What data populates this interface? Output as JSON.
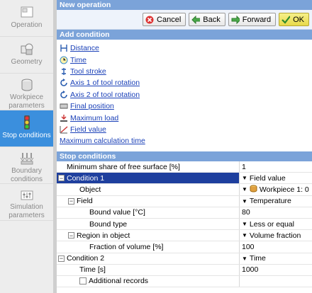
{
  "sidebar": {
    "items": [
      {
        "label": "Operation",
        "icon": "operation-icon"
      },
      {
        "label": "Geometry",
        "icon": "geometry-icon"
      },
      {
        "label": "Workpiece parameters",
        "icon": "workpiece-icon"
      },
      {
        "label": "Stop conditions",
        "icon": "traffic-light-icon",
        "active": true
      },
      {
        "label": "Boundary conditions",
        "icon": "boundary-icon"
      },
      {
        "label": "Simulation parameters",
        "icon": "simulation-icon"
      }
    ]
  },
  "header": {
    "title": "New operation"
  },
  "toolbar": {
    "cancel": "Cancel",
    "back": "Back",
    "forward": "Forward",
    "ok": "OK"
  },
  "add_condition": {
    "title": "Add condition",
    "items": [
      "Distance",
      "Time",
      "Tool stroke",
      "Axis 1 of tool rotation",
      "Axis 2 of tool rotation",
      "Final position",
      "Maximum load",
      "Field value",
      "Maximum calculation time"
    ]
  },
  "stop_conditions": {
    "title": "Stop conditions",
    "rows": [
      {
        "name": "Minimum share of free surface [%]",
        "value": "1"
      },
      {
        "name": "Condition 1",
        "value": "Field value"
      },
      {
        "name": "Object",
        "value": "Workpiece 1: 0"
      },
      {
        "name": "Field",
        "value": "Temperature"
      },
      {
        "name": "Bound value [°C]",
        "value": "80"
      },
      {
        "name": "Bound type",
        "value": "Less or equal"
      },
      {
        "name": "Region in object",
        "value": "Volume fraction"
      },
      {
        "name": "Fraction of volume [%]",
        "value": "100"
      },
      {
        "name": "Condition 2",
        "value": "Time"
      },
      {
        "name": "Time [s]",
        "value": "1000"
      },
      {
        "name": "Additional records",
        "value": ""
      }
    ]
  },
  "colors": {
    "accent": "#3b8fdd",
    "header": "#7ba3d9",
    "selected_row": "#1e3f9e",
    "link": "#1a40b8"
  }
}
